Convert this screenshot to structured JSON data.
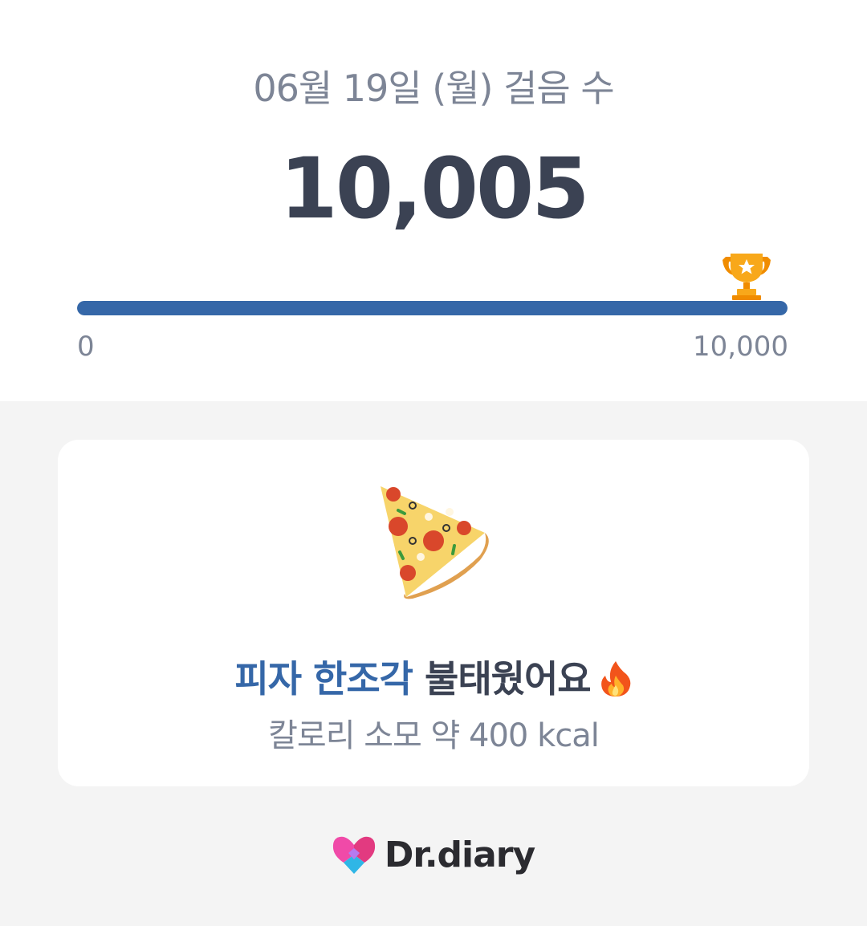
{
  "steps": {
    "date_title": "06월 19일 (월) 걸음 수",
    "count": "10,005",
    "goal_progress_fraction": 1.0,
    "scale_min": "0",
    "scale_max": "10,000",
    "goal_icon": "trophy-icon"
  },
  "card": {
    "food_icon": "pizza-icon",
    "headline_accent": "피자 한조각",
    "headline_rest": "불태웠어요",
    "headline_icon": "fire-icon",
    "calorie_text": "칼로리 소모 약 400 kcal"
  },
  "brand": {
    "logo_icon": "heart-logo-icon",
    "name": "Dr.diary"
  },
  "colors": {
    "accent": "#3567a8",
    "title_text": "#3b4253",
    "muted_text": "#7d8596",
    "background": "#f4f4f4",
    "trophy": "#f5a10f"
  }
}
